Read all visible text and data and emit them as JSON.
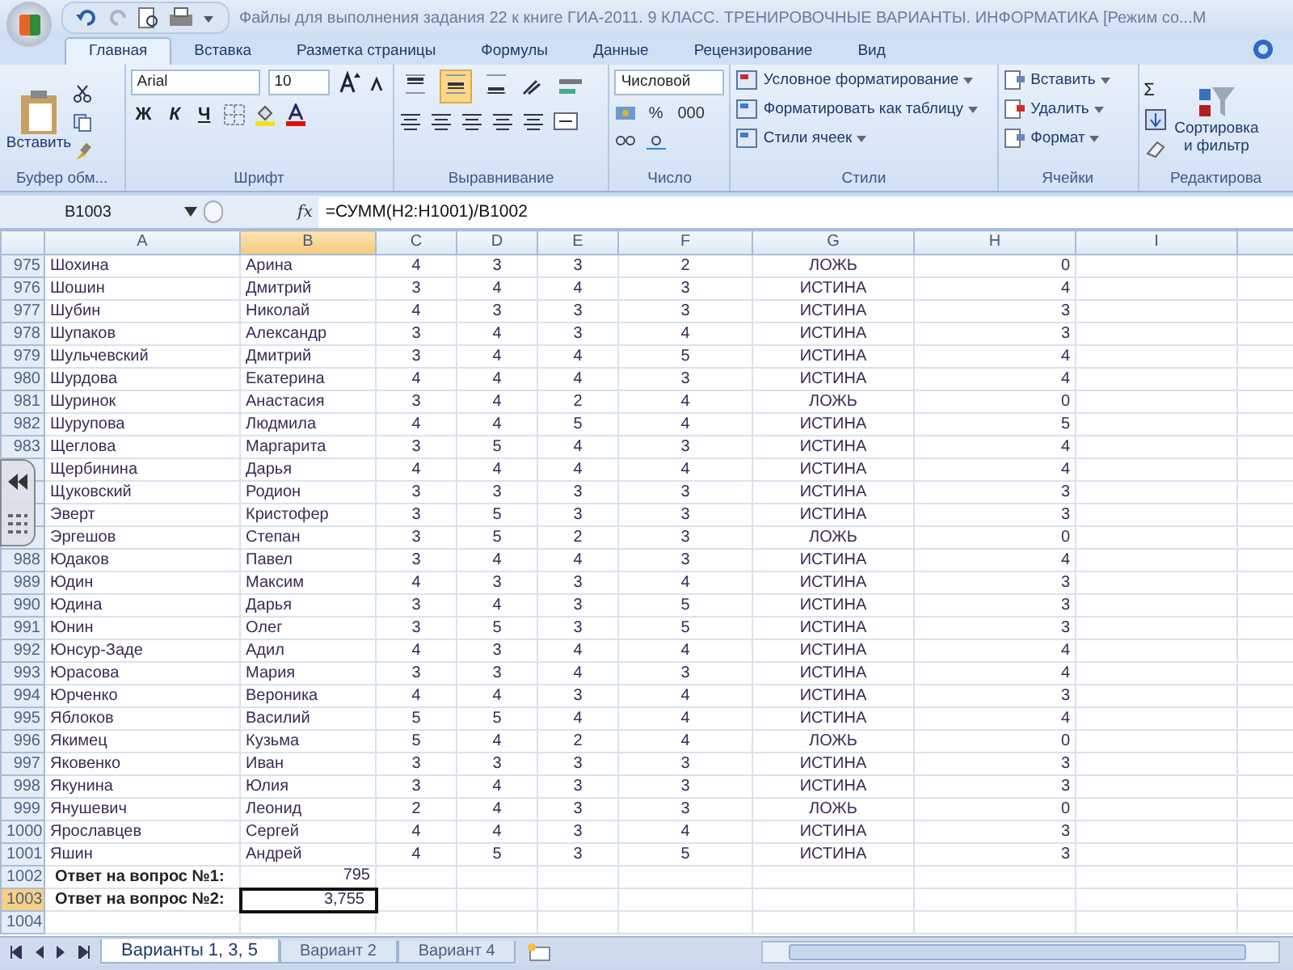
{
  "title_bar": {
    "title": "Файлы для выполнения задания 22 к книге ГИА-2011. 9 КЛАСС. ТРЕНИРОВОЧНЫЕ ВАРИАНТЫ. ИНФОРМАТИКА  [Режим со...М"
  },
  "tabs": [
    {
      "label": "Главная",
      "selected": true
    },
    {
      "label": "Вставка",
      "selected": false
    },
    {
      "label": "Разметка страницы",
      "selected": false
    },
    {
      "label": "Формулы",
      "selected": false
    },
    {
      "label": "Данные",
      "selected": false
    },
    {
      "label": "Рецензирование",
      "selected": false
    },
    {
      "label": "Вид",
      "selected": false
    }
  ],
  "ribbon": {
    "clipboard": {
      "label": "Буфер обм...",
      "paste": "Вставить"
    },
    "font": {
      "label": "Шрифт",
      "font_name": "Arial",
      "font_size": "10",
      "bold": "Ж",
      "italic": "К",
      "underline": "Ч"
    },
    "alignment": {
      "label": "Выравнивание",
      "vertical_align": [
        {
          "selected": false
        },
        {
          "selected": true
        },
        {
          "selected": false
        }
      ]
    },
    "number": {
      "label": "Число",
      "format": "Числовой",
      "percent": "%",
      "thousands": "000"
    },
    "styles": {
      "label": "Стили",
      "items": [
        "Условное форматирование",
        "Форматировать как таблицу",
        "Стили ячеек"
      ]
    },
    "cells": {
      "label": "Ячейки",
      "items": [
        "Вставить",
        "Удалить",
        "Формат"
      ]
    },
    "editing": {
      "label": "Редактирова",
      "sum": "Σ",
      "sort_line1": "Сортировка",
      "sort_line2": "и фильтр"
    }
  },
  "formula_bar": {
    "name_box": "B1003",
    "fx": "fx",
    "formula": "=СУММ(H2:H1001)/B1002"
  },
  "columns": [
    {
      "label": "A",
      "selected": false
    },
    {
      "label": "B",
      "selected": true
    },
    {
      "label": "C",
      "selected": false
    },
    {
      "label": "D",
      "selected": false
    },
    {
      "label": "E",
      "selected": false
    },
    {
      "label": "F",
      "selected": false
    },
    {
      "label": "G",
      "selected": false
    },
    {
      "label": "H",
      "selected": false
    },
    {
      "label": "I",
      "selected": false
    }
  ],
  "rows": [
    {
      "kind": "data",
      "number": "975",
      "selected": false,
      "cells": [
        "Шохина",
        "Арина",
        "4",
        "3",
        "3",
        "2",
        "ЛОЖЬ",
        "0"
      ]
    },
    {
      "kind": "data",
      "number": "976",
      "selected": false,
      "cells": [
        "Шошин",
        "Дмитрий",
        "3",
        "4",
        "4",
        "3",
        "ИСТИНА",
        "4"
      ]
    },
    {
      "kind": "data",
      "number": "977",
      "selected": false,
      "cells": [
        "Шубин",
        "Николай",
        "4",
        "3",
        "3",
        "3",
        "ИСТИНА",
        "3"
      ]
    },
    {
      "kind": "data",
      "number": "978",
      "selected": false,
      "cells": [
        "Шупаков",
        "Александр",
        "3",
        "4",
        "3",
        "4",
        "ИСТИНА",
        "3"
      ]
    },
    {
      "kind": "data",
      "number": "979",
      "selected": false,
      "cells": [
        "Шульчевский",
        "Дмитрий",
        "3",
        "4",
        "4",
        "5",
        "ИСТИНА",
        "4"
      ]
    },
    {
      "kind": "data",
      "number": "980",
      "selected": false,
      "cells": [
        "Шурдова",
        "Екатерина",
        "4",
        "4",
        "4",
        "3",
        "ИСТИНА",
        "4"
      ]
    },
    {
      "kind": "data",
      "number": "981",
      "selected": false,
      "cells": [
        "Шуринок",
        "Анастасия",
        "3",
        "4",
        "2",
        "4",
        "ЛОЖЬ",
        "0"
      ]
    },
    {
      "kind": "data",
      "number": "982",
      "selected": false,
      "cells": [
        "Шурупова",
        "Людмила",
        "4",
        "4",
        "5",
        "4",
        "ИСТИНА",
        "5"
      ]
    },
    {
      "kind": "data",
      "number": "983",
      "selected": false,
      "cells": [
        "Щеглова",
        "Маргарита",
        "3",
        "5",
        "4",
        "3",
        "ИСТИНА",
        "4"
      ]
    },
    {
      "kind": "data",
      "cells": [
        "Щербинина",
        "Дарья",
        "4",
        "4",
        "4",
        "4",
        "ИСТИНА",
        "4"
      ]
    },
    {
      "kind": "data",
      "cells": [
        "Щуковский",
        "Родион",
        "3",
        "3",
        "3",
        "3",
        "ИСТИНА",
        "3"
      ]
    },
    {
      "kind": "data",
      "cells": [
        "Эверт",
        "Кристофер",
        "3",
        "5",
        "3",
        "3",
        "ИСТИНА",
        "3"
      ]
    },
    {
      "kind": "data",
      "cells": [
        "Эргешов",
        "Степан",
        "3",
        "5",
        "2",
        "3",
        "ЛОЖЬ",
        "0"
      ]
    },
    {
      "kind": "data",
      "number": "988",
      "selected": false,
      "cells": [
        "Юдаков",
        "Павел",
        "3",
        "4",
        "4",
        "3",
        "ИСТИНА",
        "4"
      ]
    },
    {
      "kind": "data",
      "number": "989",
      "selected": false,
      "cells": [
        "Юдин",
        "Максим",
        "4",
        "3",
        "3",
        "4",
        "ИСТИНА",
        "3"
      ]
    },
    {
      "kind": "data",
      "number": "990",
      "selected": false,
      "cells": [
        "Юдина",
        "Дарья",
        "3",
        "4",
        "3",
        "5",
        "ИСТИНА",
        "3"
      ]
    },
    {
      "kind": "data",
      "number": "991",
      "selected": false,
      "cells": [
        "Юнин",
        "Олег",
        "3",
        "5",
        "3",
        "5",
        "ИСТИНА",
        "3"
      ]
    },
    {
      "kind": "data",
      "number": "992",
      "selected": false,
      "cells": [
        "Юнсур-Заде",
        "Адил",
        "4",
        "3",
        "4",
        "4",
        "ИСТИНА",
        "4"
      ]
    },
    {
      "kind": "data",
      "number": "993",
      "selected": false,
      "cells": [
        "Юрасова",
        "Мария",
        "3",
        "3",
        "4",
        "3",
        "ИСТИНА",
        "4"
      ]
    },
    {
      "kind": "data",
      "number": "994",
      "selected": false,
      "cells": [
        "Юрченко",
        "Вероника",
        "4",
        "4",
        "3",
        "4",
        "ИСТИНА",
        "3"
      ]
    },
    {
      "kind": "data",
      "number": "995",
      "selected": false,
      "cells": [
        "Яблоков",
        "Василий",
        "5",
        "5",
        "4",
        "4",
        "ИСТИНА",
        "4"
      ]
    },
    {
      "kind": "data",
      "number": "996",
      "selected": false,
      "cells": [
        "Якимец",
        "Кузьма",
        "5",
        "4",
        "2",
        "4",
        "ЛОЖЬ",
        "0"
      ]
    },
    {
      "kind": "data",
      "number": "997",
      "selected": false,
      "cells": [
        "Яковенко",
        "Иван",
        "3",
        "3",
        "3",
        "3",
        "ИСТИНА",
        "3"
      ]
    },
    {
      "kind": "data",
      "number": "998",
      "selected": false,
      "cells": [
        "Якунина",
        "Юлия",
        "3",
        "4",
        "3",
        "3",
        "ИСТИНА",
        "3"
      ]
    },
    {
      "kind": "data",
      "number": "999",
      "selected": false,
      "cells": [
        "Янушевич",
        "Леонид",
        "2",
        "4",
        "3",
        "3",
        "ЛОЖЬ",
        "0"
      ]
    },
    {
      "kind": "data",
      "number": "1000",
      "selected": false,
      "cells": [
        "Ярославцев",
        "Сергей",
        "4",
        "4",
        "3",
        "4",
        "ИСТИНА",
        "3"
      ]
    },
    {
      "kind": "data",
      "number": "1001",
      "selected": false,
      "cells": [
        "Яшин",
        "Андрей",
        "4",
        "5",
        "3",
        "5",
        "ИСТИНА",
        "3"
      ]
    },
    {
      "kind": "answer",
      "number": "1002",
      "selected": false,
      "label": "Ответ на вопрос №1:",
      "value": "795"
    },
    {
      "kind": "answer",
      "number": "1003",
      "selected": true,
      "label": "Ответ на вопрос №2:",
      "value": "3,755"
    },
    {
      "kind": "empty",
      "number": "1004",
      "selected": false
    }
  ],
  "sheet_tabs": [
    {
      "label": "Варианты 1, 3, 5",
      "selected": true
    },
    {
      "label": "Вариант 2",
      "selected": false
    },
    {
      "label": "Вариант 4",
      "selected": false
    }
  ]
}
